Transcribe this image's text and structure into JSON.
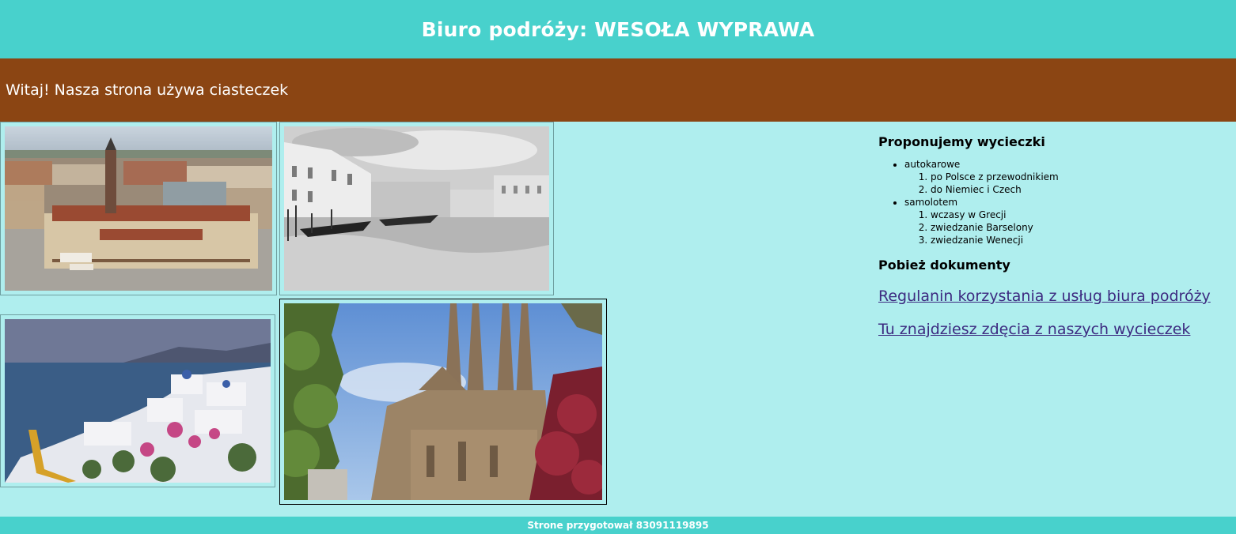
{
  "header": {
    "title": "Biuro podróży: WESOŁA WYPRAWA"
  },
  "cookie": {
    "text": "Witaj! Nasza strona używa ciasteczek"
  },
  "gallery": {
    "photos": [
      {
        "name": "krakow-market-square-photo"
      },
      {
        "name": "venice-canal-photo"
      },
      {
        "name": "santorini-photo"
      },
      {
        "name": "sagrada-familia-photo"
      }
    ]
  },
  "aside": {
    "trips_heading": "Proponujemy wycieczki",
    "trips": [
      {
        "label": "autokarowe",
        "items": [
          "po Polsce z przewodnikiem",
          "do Niemiec i Czech"
        ]
      },
      {
        "label": "samolotem",
        "items": [
          "wczasy w Grecji",
          "zwiedzanie Barselony",
          "zwiedzanie Wenecji"
        ]
      }
    ],
    "docs_heading": "Pobież dokumenty",
    "links": {
      "rules": "Regulanin korzystania z usług biura podróży",
      "photos": "Tu znajdziesz zdęcia z naszych wycieczek"
    }
  },
  "footer": {
    "text": "Strone przygotował 83091119895"
  },
  "colors": {
    "header_bg": "#48d1cc",
    "cookie_bg": "#8b4513",
    "main_bg": "#afeeee",
    "link": "#3c2a80"
  }
}
